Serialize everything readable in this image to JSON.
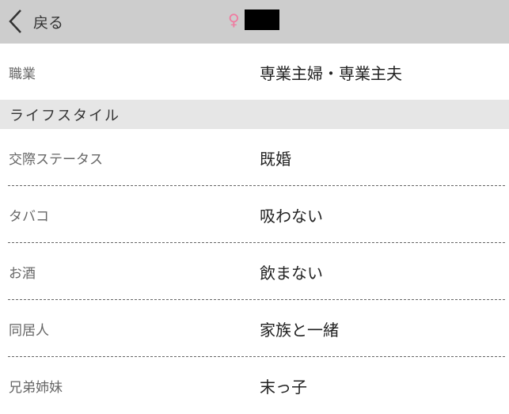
{
  "header": {
    "back_label": "戻る",
    "sex_symbol": "♀"
  },
  "occupation": {
    "label": "職業",
    "value": "専業主婦・専業主夫"
  },
  "lifestyle": {
    "section_title": "ライフスタイル",
    "rows": [
      {
        "label": "交際ステータス",
        "value": "既婚"
      },
      {
        "label": "タバコ",
        "value": "吸わない"
      },
      {
        "label": "お酒",
        "value": "飲まない"
      },
      {
        "label": "同居人",
        "value": "家族と一緒"
      },
      {
        "label": "兄弟姉妹",
        "value": "末っ子"
      }
    ]
  },
  "colors": {
    "header_bg": "#cdcdcd",
    "section_bg": "#e6e6e6",
    "female_pink": "#f07aa0"
  }
}
